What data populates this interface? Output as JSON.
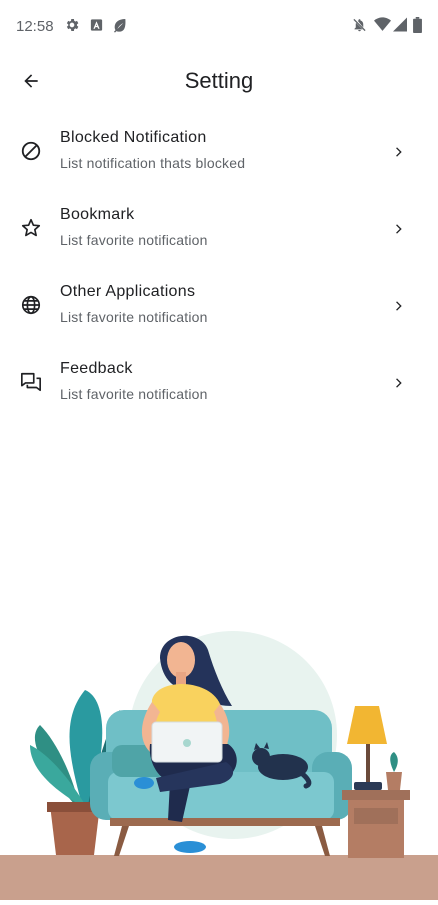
{
  "status_bar": {
    "time": "12:58",
    "left_icons": [
      "gear-icon",
      "a-box-icon",
      "leaf-icon"
    ],
    "right_icons": [
      "bell-off-icon",
      "wifi-icon",
      "signal-icon",
      "battery-icon"
    ]
  },
  "app_bar": {
    "back_icon": "arrow-left-icon",
    "title": "Setting"
  },
  "settings": [
    {
      "icon": "block-icon",
      "title": "Blocked Notification",
      "subtitle": "List notification thats blocked"
    },
    {
      "icon": "star-outline-icon",
      "title": "Bookmark",
      "subtitle": "List favorite notification"
    },
    {
      "icon": "globe-icon",
      "title": "Other Applications",
      "subtitle": "List favorite notification"
    },
    {
      "icon": "chat-bubbles-icon",
      "title": "Feedback",
      "subtitle": "List favorite notification"
    }
  ],
  "colors": {
    "text_primary": "#202124",
    "text_secondary": "#5f6368",
    "sofa": "#6fbfc6",
    "shirt": "#f9d25e",
    "jeans": "#1f2b4d",
    "floor": "#c9a08d",
    "backdrop": "#e8f3ef"
  }
}
